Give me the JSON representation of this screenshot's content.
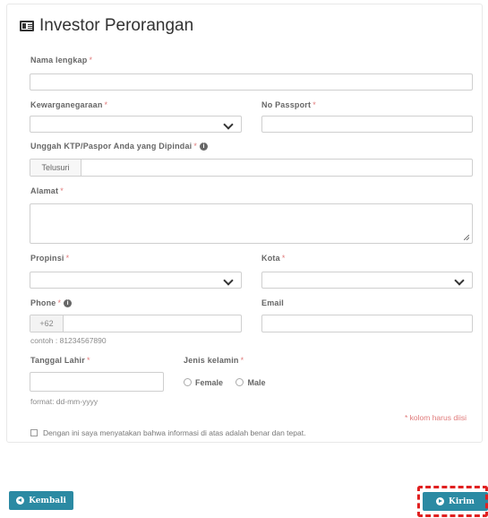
{
  "form": {
    "title": "Investor Perorangan",
    "required_mark": "*",
    "nama_label": "Nama lengkap",
    "kewarganegaraan_label": "Kewarganegaraan",
    "passport_label": "No Passport",
    "upload_label": "Unggah KTP/Paspor Anda yang Dipindai",
    "upload_button": "Telusuri",
    "alamat_label": "Alamat",
    "propinsi_label": "Propinsi",
    "kota_label": "Kota",
    "phone_label": "Phone",
    "phone_prefix": "+62",
    "phone_hint": "contoh : 81234567890",
    "email_label": "Email",
    "tanggal_label": "Tanggal Lahir",
    "tanggal_hint": "format: dd-mm-yyyy",
    "gender_label": "Jenis kelamin",
    "gender_options": [
      "Female",
      "Male"
    ],
    "required_note": "* kolom harus diisi",
    "agreement_text": "Dengan ini saya menyatakan bahwa informasi di atas adalah benar dan tepat."
  },
  "footer": {
    "back_label": "Kembali",
    "submit_label": "Kirim"
  },
  "colors": {
    "button": "#2b8aa3",
    "highlight": "#e02020",
    "required": "#e07a7a"
  },
  "icons": [
    "id-card-icon",
    "info-icon",
    "chevron-down-icon",
    "resize-handle-icon",
    "arrow-left-circle-icon",
    "arrow-right-circle-icon"
  ]
}
